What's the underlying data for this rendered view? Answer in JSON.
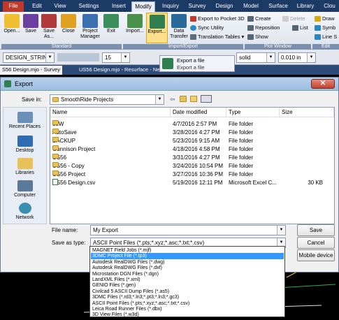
{
  "ribbon": {
    "menu_tabs": [
      "File",
      "Edit",
      "View",
      "Settings",
      "Insert",
      "Modify",
      "Inquiry",
      "Survey",
      "Design",
      "Model",
      "Surface",
      "Library",
      "Clou"
    ],
    "buttons": [
      "Open...",
      "Save",
      "Save As...",
      "Close",
      "Project Manager",
      "Exit",
      "Import...",
      "Export...",
      "Data Transfer"
    ],
    "small_items": [
      "Export to Pocket 3D",
      "Sync Utility",
      "Translation Tables ▾",
      "Create",
      "Delete",
      "Reposition",
      "List",
      "Show",
      "Draw",
      "Symb",
      "Line S"
    ],
    "groups": [
      "Standard",
      "Import/Export",
      "Plot Window",
      "Edit"
    ]
  },
  "toolbar": {
    "layer": "DESIGN_STRING",
    "width_value": "15",
    "linetype": "solid",
    "lineweight": "0.010 in"
  },
  "doc_tabs": [
    "S56 Design.mjo - Survey",
    "US56 Design.mjo - Resurface - New"
  ],
  "tooltip": {
    "title": "Export a file",
    "desc": "Export a file"
  },
  "dialog": {
    "title": "Export",
    "close": "✕",
    "save_in_label": "Save in:",
    "save_in_value": "SmoothRide Projects",
    "places": [
      "Recent Places",
      "Desktop",
      "Libraries",
      "Computer",
      "Network"
    ],
    "columns": [
      "Name",
      "Date modified",
      "Type",
      "Size"
    ],
    "files": [
      {
        "name": "35W",
        "date": "4/7/2016 2:57 PM",
        "type": "File folder",
        "size": "",
        "kind": "folder"
      },
      {
        "name": "AutoSave",
        "date": "3/28/2016 4:27 PM",
        "type": "File folder",
        "size": "",
        "kind": "folder"
      },
      {
        "name": "BACKUP",
        "date": "5/23/2016 9:15 AM",
        "type": "File folder",
        "size": "",
        "kind": "folder"
      },
      {
        "name": "Gunnison Project",
        "date": "4/18/2016 4:58 PM",
        "type": "File folder",
        "size": "",
        "kind": "folder"
      },
      {
        "name": "US56",
        "date": "3/31/2016 4:27 PM",
        "type": "File folder",
        "size": "",
        "kind": "folder"
      },
      {
        "name": "US56 - Copy",
        "date": "3/24/2016 10:54 PM",
        "type": "File folder",
        "size": "",
        "kind": "folder"
      },
      {
        "name": "US56 Project",
        "date": "3/27/2016 10:36 PM",
        "type": "File folder",
        "size": "",
        "kind": "folder"
      },
      {
        "name": "US56 Design.csv",
        "date": "5/19/2016 12:11 PM",
        "type": "Microsoft Excel C...",
        "size": "30 KB",
        "kind": "csv"
      }
    ],
    "file_name_label": "File name:",
    "file_name_value": "My Export",
    "save_type_label": "Save as type:",
    "save_type_value": "ASCII Point Files (*.pts;*.xyz;*.asc;*.txt;*.csv)",
    "save_button": "Save",
    "cancel_button": "Cancel",
    "mobile_button": "Mobile device"
  },
  "type_options": [
    "MAGNET Field Jobs (*.mjf)",
    "3DMC Project File (*.tp3)",
    "Autodesk RealDWG Files (*.dwg)",
    "Autodesk RealDWG Files (*.dxf)",
    "Microstation DGN Files (*.dgn)",
    "LandXML Files (*.xml)",
    "GENIO Files (*.gen)",
    "Civilcad 5 ASCII Dump Files (*.as5)",
    "3DMC Files (*.rd3;*.ln3;*.pt3;*.ln3;*.gc3)",
    "ASCII Point Files (*.pts;*.xyz;*.asc;*.txt;*.csv)",
    "Leica Road Runner Files (*.dbx)",
    "3D View Files (*.w3d)"
  ],
  "selected_type_index": 1,
  "colors": {
    "menubar": "#1c3a66",
    "selection": "#3399ff",
    "accent": "#d35400"
  }
}
